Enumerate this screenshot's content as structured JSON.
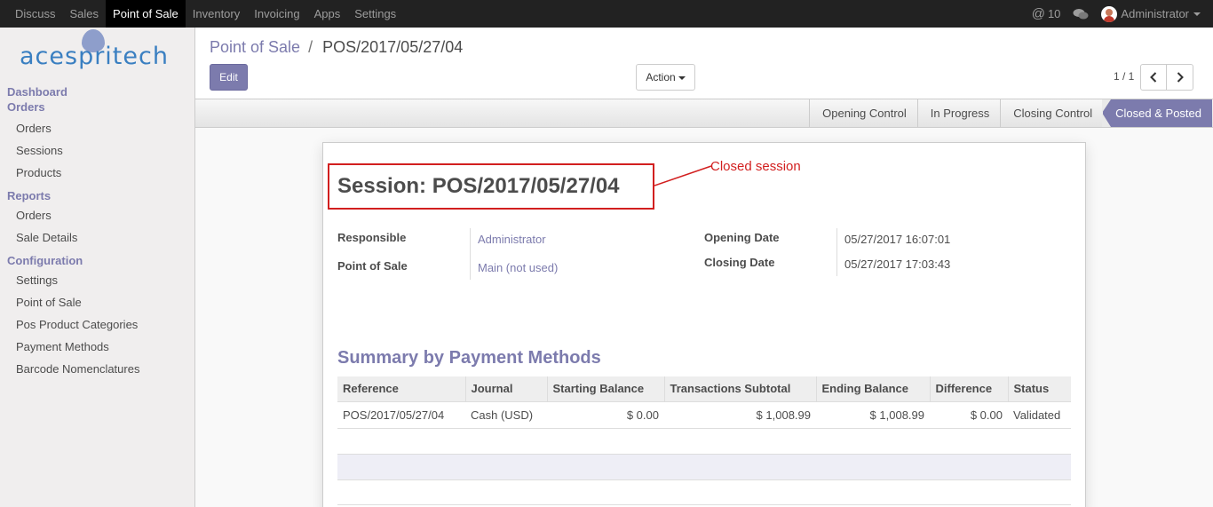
{
  "topbar": {
    "apps": [
      "Discuss",
      "Sales",
      "Point of Sale",
      "Inventory",
      "Invoicing",
      "Apps",
      "Settings"
    ],
    "active_app": "Point of Sale",
    "mentions_count": "10",
    "user": "Administrator"
  },
  "logo": {
    "text": "acespritech"
  },
  "sidebar": {
    "dashboard": "Dashboard",
    "orders_section": "Orders",
    "orders_items": [
      "Orders",
      "Sessions",
      "Products"
    ],
    "reports_section": "Reports",
    "reports_items": [
      "Orders",
      "Sale Details"
    ],
    "config_section": "Configuration",
    "config_items": [
      "Settings",
      "Point of Sale",
      "Pos Product Categories",
      "Payment Methods",
      "Barcode Nomenclatures"
    ]
  },
  "control_panel": {
    "breadcrumb_parent": "Point of Sale",
    "breadcrumb_sep": "/",
    "breadcrumb_current": "POS/2017/05/27/04",
    "edit_label": "Edit",
    "action_label": "Action",
    "pager": "1 / 1"
  },
  "statusbar": {
    "stages": [
      "Opening Control",
      "In Progress",
      "Closing Control",
      "Closed & Posted"
    ],
    "active_stage": "Closed & Posted"
  },
  "form": {
    "title": "Session: POS/2017/05/27/04",
    "annotation": "Closed session",
    "responsible_label": "Responsible",
    "responsible_value": "Administrator",
    "pos_label": "Point of Sale",
    "pos_value": "Main (not used)",
    "opening_label": "Opening Date",
    "opening_value": "05/27/2017 16:07:01",
    "closing_label": "Closing Date",
    "closing_value": "05/27/2017 17:03:43",
    "summary_title": "Summary by Payment Methods",
    "table": {
      "headers": [
        "Reference",
        "Journal",
        "Starting Balance",
        "Transactions Subtotal",
        "Ending Balance",
        "Difference",
        "Status"
      ],
      "rows": [
        [
          "POS/2017/05/27/04",
          "Cash (USD)",
          "$ 0.00",
          "$ 1,008.99",
          "$ 1,008.99",
          "$ 0.00",
          "Validated"
        ]
      ]
    }
  },
  "colors": {
    "accent": "#7c7bad",
    "annotation": "#d21f1f",
    "topbar": "#222222"
  }
}
